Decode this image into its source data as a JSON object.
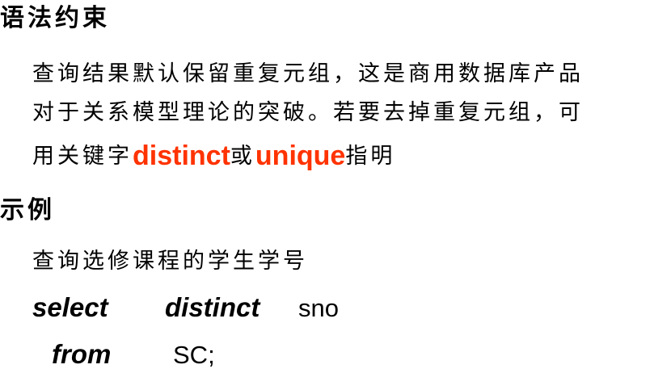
{
  "syntax": {
    "heading": "语法约束",
    "line1": "查询结果默认保留重复元组，这是商用数据库产品",
    "line2": "对于关系模型理论的突破。若要去掉重复元组，可",
    "line3_prefix": "用关键字",
    "kw_distinct": "distinct",
    "line3_mid": "或",
    "kw_unique": "unique",
    "line3_suffix": "指明"
  },
  "example": {
    "heading": "示例",
    "description": "查询选修课程的学生学号",
    "code": {
      "select_kw": "select",
      "distinct_kw": "distinct",
      "column": "sno",
      "from_kw": "from",
      "table": "SC;"
    }
  },
  "colors": {
    "keyword_highlight": "#ff3300",
    "text": "#000000",
    "background": "#ffffff"
  }
}
